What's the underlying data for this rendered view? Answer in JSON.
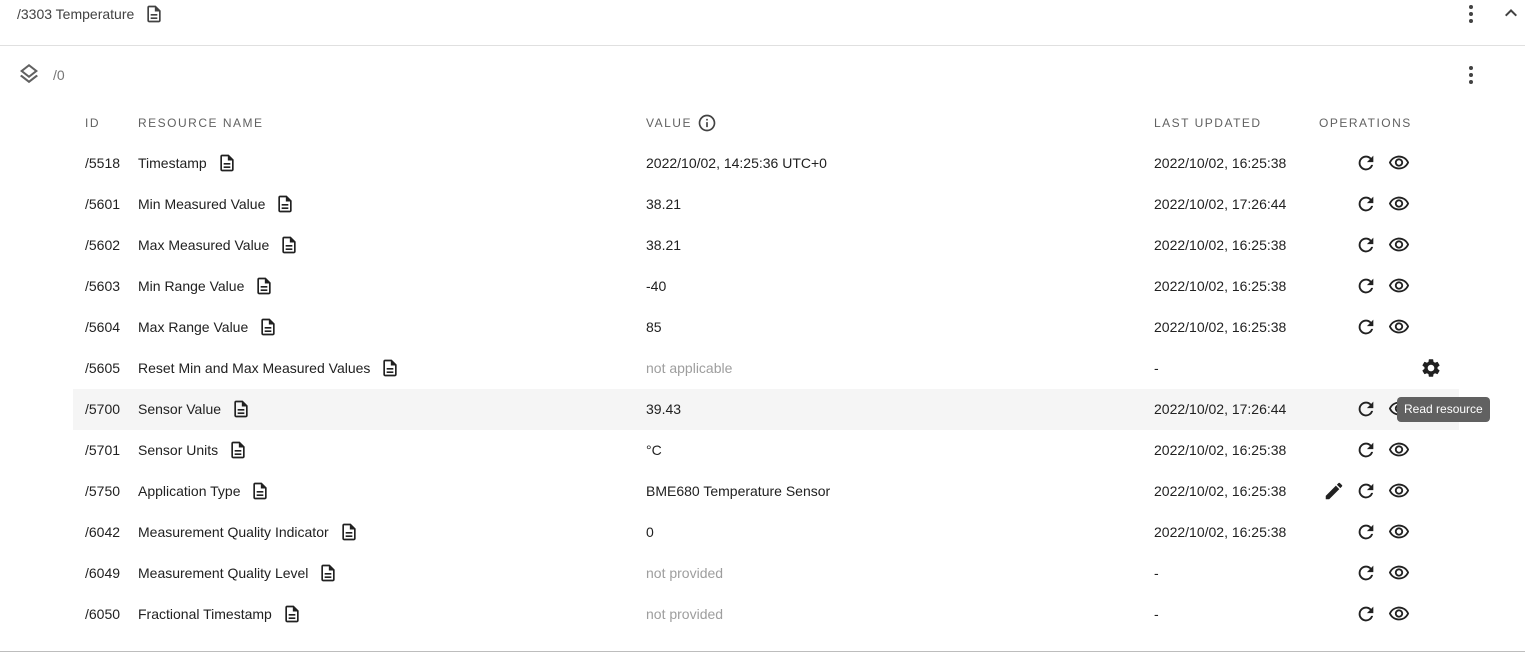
{
  "object": {
    "title": "/3303 Temperature"
  },
  "instance": {
    "label": "/0"
  },
  "table": {
    "headers": {
      "id": "ID",
      "name": "RESOURCE NAME",
      "value": "VALUE",
      "last_updated": "LAST UPDATED",
      "operations": "OPERATIONS"
    },
    "rows": [
      {
        "id": "/5518",
        "name": "Timestamp",
        "value": "2022/10/02, 14:25:36 UTC+0",
        "updated": "2022/10/02, 16:25:38"
      },
      {
        "id": "/5601",
        "name": "Min Measured Value",
        "value": "38.21",
        "updated": "2022/10/02, 17:26:44"
      },
      {
        "id": "/5602",
        "name": "Max Measured Value",
        "value": "38.21",
        "updated": "2022/10/02, 16:25:38"
      },
      {
        "id": "/5603",
        "name": "Min Range Value",
        "value": "-40",
        "updated": "2022/10/02, 16:25:38"
      },
      {
        "id": "/5604",
        "name": "Max Range Value",
        "value": "85",
        "updated": "2022/10/02, 16:25:38"
      },
      {
        "id": "/5605",
        "name": "Reset Min and Max Measured Values",
        "value": "not applicable",
        "updated": "-"
      },
      {
        "id": "/5700",
        "name": "Sensor Value",
        "value": "39.43",
        "updated": "2022/10/02, 17:26:44"
      },
      {
        "id": "/5701",
        "name": "Sensor Units",
        "value": "°C",
        "updated": "2022/10/02, 16:25:38"
      },
      {
        "id": "/5750",
        "name": "Application Type",
        "value": "BME680 Temperature Sensor",
        "updated": "2022/10/02, 16:25:38"
      },
      {
        "id": "/6042",
        "name": "Measurement Quality Indicator",
        "value": "0",
        "updated": "2022/10/02, 16:25:38"
      },
      {
        "id": "/6049",
        "name": "Measurement Quality Level",
        "value": "not provided",
        "updated": "-"
      },
      {
        "id": "/6050",
        "name": "Fractional Timestamp",
        "value": "not provided",
        "updated": "-"
      }
    ]
  },
  "tooltip": {
    "text": "Read resource"
  },
  "icons": {
    "doc": "description-icon",
    "layers": "layers-icon",
    "kebab": "more-vert-icon",
    "chevron": "chevron-up-icon",
    "info": "info-icon",
    "refresh": "refresh-icon",
    "eye": "visibility-icon",
    "edit": "edit-icon",
    "exec": "settings-icon"
  },
  "colors": {
    "muted": "#9e9e9e",
    "highlight_row": "#f5f5f5",
    "tooltip_bg": "#616161"
  }
}
